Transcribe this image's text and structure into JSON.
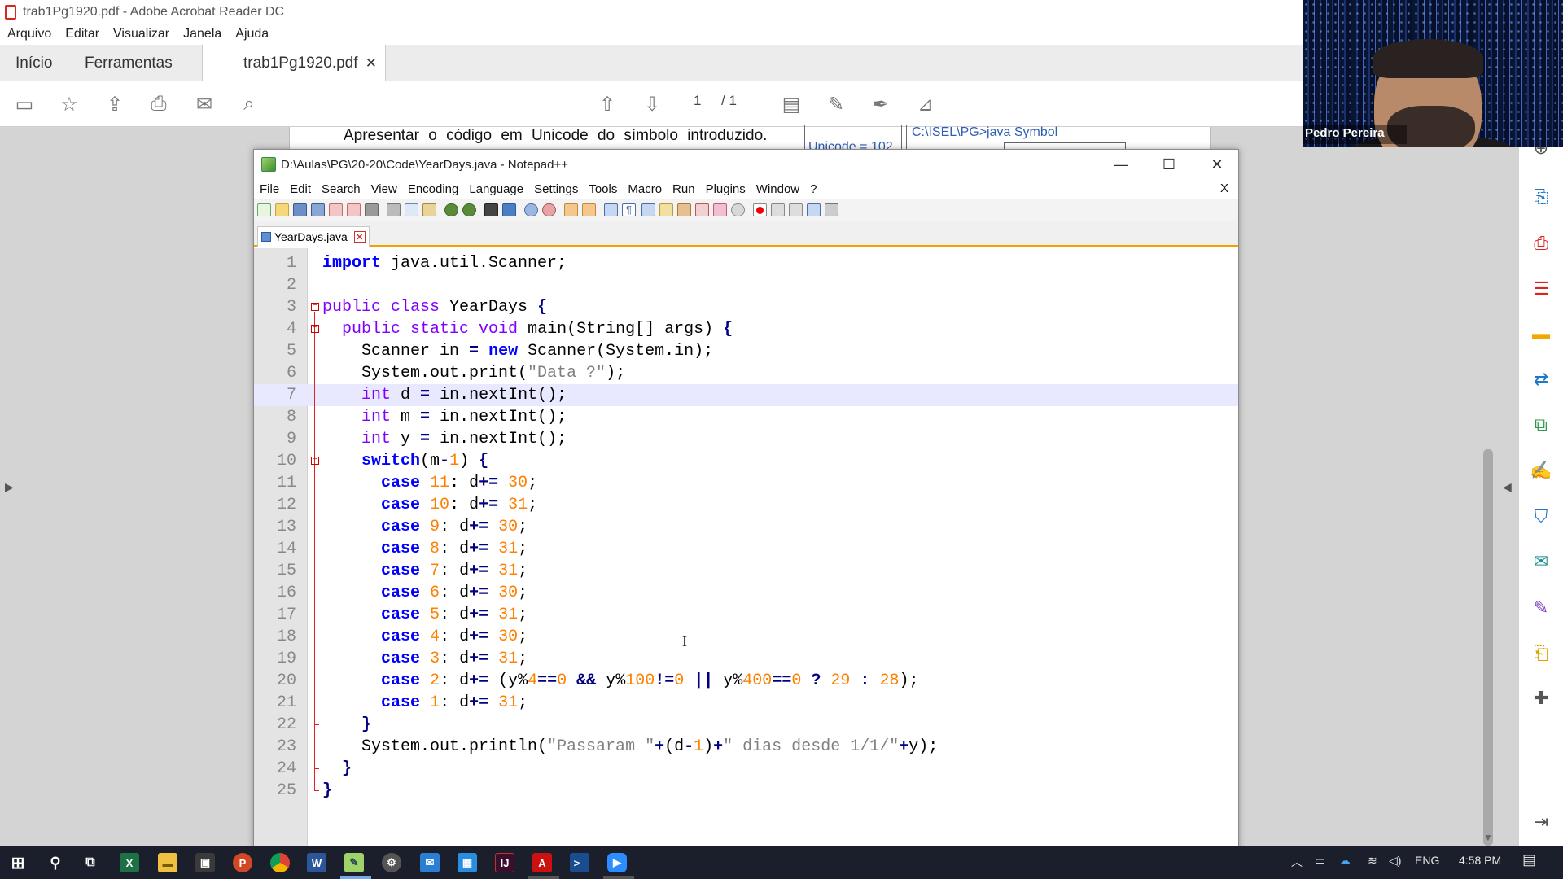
{
  "acrobat": {
    "title": "trab1Pg1920.pdf - Adobe Acrobat Reader DC",
    "menu": [
      "Arquivo",
      "Editar",
      "Visualizar",
      "Janela",
      "Ajuda"
    ],
    "tabs": {
      "home": "Início",
      "tools": "Ferramentas",
      "doc": "trab1Pg1920.pdf"
    },
    "page_current": "1",
    "page_total": "/ 1",
    "pdf_text": "Apresentar o código em Unicode do símbolo introduzido.",
    "pdf_box_text": "Unicode = 102",
    "pdf_box2_text": "C:\\ISEL\\PG>java Symbol"
  },
  "webcam": {
    "name": "Pedro Pereira"
  },
  "npp": {
    "title": "D:\\Aulas\\PG\\20-20\\Code\\YearDays.java - Notepad++",
    "menu": [
      "File",
      "Edit",
      "Search",
      "View",
      "Encoding",
      "Language",
      "Settings",
      "Tools",
      "Macro",
      "Run",
      "Plugins",
      "Window",
      "?"
    ],
    "close_x": "X",
    "tab": "YearDays.java"
  },
  "taskbar": {
    "lang": "ENG",
    "time": "4:58 PM"
  },
  "colors": {
    "keyword": "#0000ff",
    "type": "#8000ff",
    "string": "#808080",
    "number": "#ff8000",
    "operator": "#000080",
    "current_line": "#e8e8ff"
  },
  "code": [
    [
      [
        "kw",
        "import"
      ],
      [
        "pl",
        " java.util.Scanner;"
      ]
    ],
    [],
    [
      [
        "ty",
        "public class"
      ],
      [
        "pl",
        " YearDays "
      ],
      [
        "op",
        "{"
      ]
    ],
    [
      [
        "pl",
        "  "
      ],
      [
        "ty",
        "public static void"
      ],
      [
        "pl",
        " main(String[] args) "
      ],
      [
        "op",
        "{"
      ]
    ],
    [
      [
        "pl",
        "    Scanner in "
      ],
      [
        "op",
        "="
      ],
      [
        "pl",
        " "
      ],
      [
        "kw",
        "new"
      ],
      [
        "pl",
        " Scanner(System.in);"
      ]
    ],
    [
      [
        "pl",
        "    System.out.print("
      ],
      [
        "st",
        "\"Data ?\""
      ],
      [
        "pl",
        ");"
      ]
    ],
    [
      [
        "pl",
        "    "
      ],
      [
        "ty",
        "int"
      ],
      [
        "pl",
        " d "
      ],
      [
        "op",
        "="
      ],
      [
        "pl",
        " in.nextInt();"
      ]
    ],
    [
      [
        "pl",
        "    "
      ],
      [
        "ty",
        "int"
      ],
      [
        "pl",
        " m "
      ],
      [
        "op",
        "="
      ],
      [
        "pl",
        " in.nextInt();"
      ]
    ],
    [
      [
        "pl",
        "    "
      ],
      [
        "ty",
        "int"
      ],
      [
        "pl",
        " y "
      ],
      [
        "op",
        "="
      ],
      [
        "pl",
        " in.nextInt();"
      ]
    ],
    [
      [
        "pl",
        "    "
      ],
      [
        "kw",
        "switch"
      ],
      [
        "pl",
        "(m"
      ],
      [
        "op",
        "-"
      ],
      [
        "nm",
        "1"
      ],
      [
        "pl",
        ") "
      ],
      [
        "op",
        "{"
      ]
    ],
    [
      [
        "pl",
        "      "
      ],
      [
        "kw",
        "case"
      ],
      [
        "pl",
        " "
      ],
      [
        "nm",
        "11"
      ],
      [
        "pl",
        ": d"
      ],
      [
        "op",
        "+="
      ],
      [
        "pl",
        " "
      ],
      [
        "nm",
        "30"
      ],
      [
        "pl",
        ";"
      ]
    ],
    [
      [
        "pl",
        "      "
      ],
      [
        "kw",
        "case"
      ],
      [
        "pl",
        " "
      ],
      [
        "nm",
        "10"
      ],
      [
        "pl",
        ": d"
      ],
      [
        "op",
        "+="
      ],
      [
        "pl",
        " "
      ],
      [
        "nm",
        "31"
      ],
      [
        "pl",
        ";"
      ]
    ],
    [
      [
        "pl",
        "      "
      ],
      [
        "kw",
        "case"
      ],
      [
        "pl",
        " "
      ],
      [
        "nm",
        "9"
      ],
      [
        "pl",
        ": d"
      ],
      [
        "op",
        "+="
      ],
      [
        "pl",
        " "
      ],
      [
        "nm",
        "30"
      ],
      [
        "pl",
        ";"
      ]
    ],
    [
      [
        "pl",
        "      "
      ],
      [
        "kw",
        "case"
      ],
      [
        "pl",
        " "
      ],
      [
        "nm",
        "8"
      ],
      [
        "pl",
        ": d"
      ],
      [
        "op",
        "+="
      ],
      [
        "pl",
        " "
      ],
      [
        "nm",
        "31"
      ],
      [
        "pl",
        ";"
      ]
    ],
    [
      [
        "pl",
        "      "
      ],
      [
        "kw",
        "case"
      ],
      [
        "pl",
        " "
      ],
      [
        "nm",
        "7"
      ],
      [
        "pl",
        ": d"
      ],
      [
        "op",
        "+="
      ],
      [
        "pl",
        " "
      ],
      [
        "nm",
        "31"
      ],
      [
        "pl",
        ";"
      ]
    ],
    [
      [
        "pl",
        "      "
      ],
      [
        "kw",
        "case"
      ],
      [
        "pl",
        " "
      ],
      [
        "nm",
        "6"
      ],
      [
        "pl",
        ": d"
      ],
      [
        "op",
        "+="
      ],
      [
        "pl",
        " "
      ],
      [
        "nm",
        "30"
      ],
      [
        "pl",
        ";"
      ]
    ],
    [
      [
        "pl",
        "      "
      ],
      [
        "kw",
        "case"
      ],
      [
        "pl",
        " "
      ],
      [
        "nm",
        "5"
      ],
      [
        "pl",
        ": d"
      ],
      [
        "op",
        "+="
      ],
      [
        "pl",
        " "
      ],
      [
        "nm",
        "31"
      ],
      [
        "pl",
        ";"
      ]
    ],
    [
      [
        "pl",
        "      "
      ],
      [
        "kw",
        "case"
      ],
      [
        "pl",
        " "
      ],
      [
        "nm",
        "4"
      ],
      [
        "pl",
        ": d"
      ],
      [
        "op",
        "+="
      ],
      [
        "pl",
        " "
      ],
      [
        "nm",
        "30"
      ],
      [
        "pl",
        ";"
      ]
    ],
    [
      [
        "pl",
        "      "
      ],
      [
        "kw",
        "case"
      ],
      [
        "pl",
        " "
      ],
      [
        "nm",
        "3"
      ],
      [
        "pl",
        ": d"
      ],
      [
        "op",
        "+="
      ],
      [
        "pl",
        " "
      ],
      [
        "nm",
        "31"
      ],
      [
        "pl",
        ";"
      ]
    ],
    [
      [
        "pl",
        "      "
      ],
      [
        "kw",
        "case"
      ],
      [
        "pl",
        " "
      ],
      [
        "nm",
        "2"
      ],
      [
        "pl",
        ": d"
      ],
      [
        "op",
        "+="
      ],
      [
        "pl",
        " (y%"
      ],
      [
        "nm",
        "4"
      ],
      [
        "op",
        "=="
      ],
      [
        "nm",
        "0"
      ],
      [
        "pl",
        " "
      ],
      [
        "op",
        "&&"
      ],
      [
        "pl",
        " y%"
      ],
      [
        "nm",
        "100"
      ],
      [
        "op",
        "!="
      ],
      [
        "nm",
        "0"
      ],
      [
        "pl",
        " "
      ],
      [
        "op",
        "||"
      ],
      [
        "pl",
        " y%"
      ],
      [
        "nm",
        "400"
      ],
      [
        "op",
        "=="
      ],
      [
        "nm",
        "0"
      ],
      [
        "pl",
        " "
      ],
      [
        "op",
        "?"
      ],
      [
        "pl",
        " "
      ],
      [
        "nm",
        "29"
      ],
      [
        "pl",
        " "
      ],
      [
        "op",
        ":"
      ],
      [
        "pl",
        " "
      ],
      [
        "nm",
        "28"
      ],
      [
        "pl",
        ");"
      ]
    ],
    [
      [
        "pl",
        "      "
      ],
      [
        "kw",
        "case"
      ],
      [
        "pl",
        " "
      ],
      [
        "nm",
        "1"
      ],
      [
        "pl",
        ": d"
      ],
      [
        "op",
        "+="
      ],
      [
        "pl",
        " "
      ],
      [
        "nm",
        "31"
      ],
      [
        "pl",
        ";"
      ]
    ],
    [
      [
        "pl",
        "    "
      ],
      [
        "op",
        "}"
      ]
    ],
    [
      [
        "pl",
        "    System.out.println("
      ],
      [
        "st",
        "\"Passaram \""
      ],
      [
        "op",
        "+"
      ],
      [
        "pl",
        "(d"
      ],
      [
        "op",
        "-"
      ],
      [
        "nm",
        "1"
      ],
      [
        "pl",
        ")"
      ],
      [
        "op",
        "+"
      ],
      [
        "st",
        "\" dias desde 1/1/\""
      ],
      [
        "op",
        "+"
      ],
      [
        "pl",
        "y);"
      ]
    ],
    [
      [
        "pl",
        "  "
      ],
      [
        "op",
        "}"
      ]
    ],
    [
      [
        "op",
        "}"
      ]
    ]
  ]
}
